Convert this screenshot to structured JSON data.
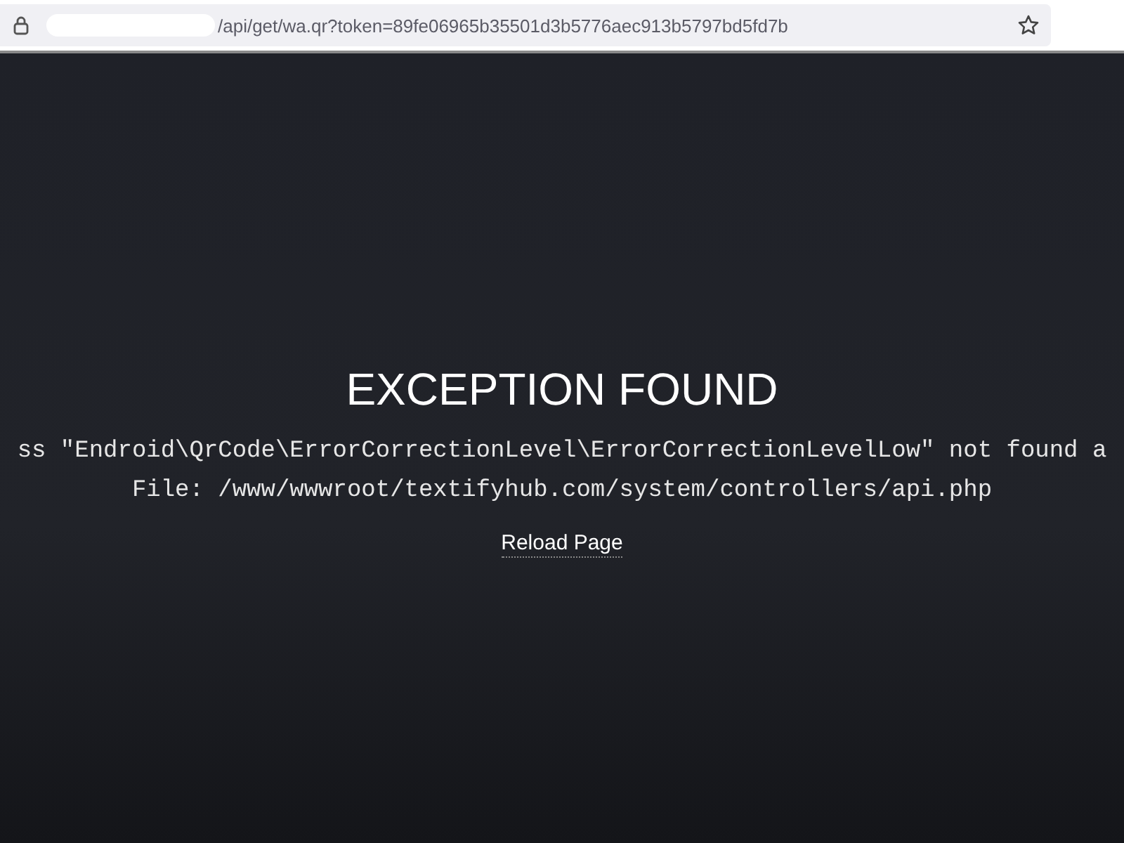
{
  "address_bar": {
    "url": "/api/get/wa.qr?token=89fe06965b35501d3b5776aec913b5797bd5fd7b"
  },
  "page": {
    "title": "EXCEPTION FOUND",
    "message": "ss \"Endroid\\QrCode\\ErrorCorrectionLevel\\ErrorCorrectionLevelLow\" not found a",
    "file": "File: /www/wwwroot/textifyhub.com/system/controllers/api.php",
    "link": "Reload Page"
  }
}
